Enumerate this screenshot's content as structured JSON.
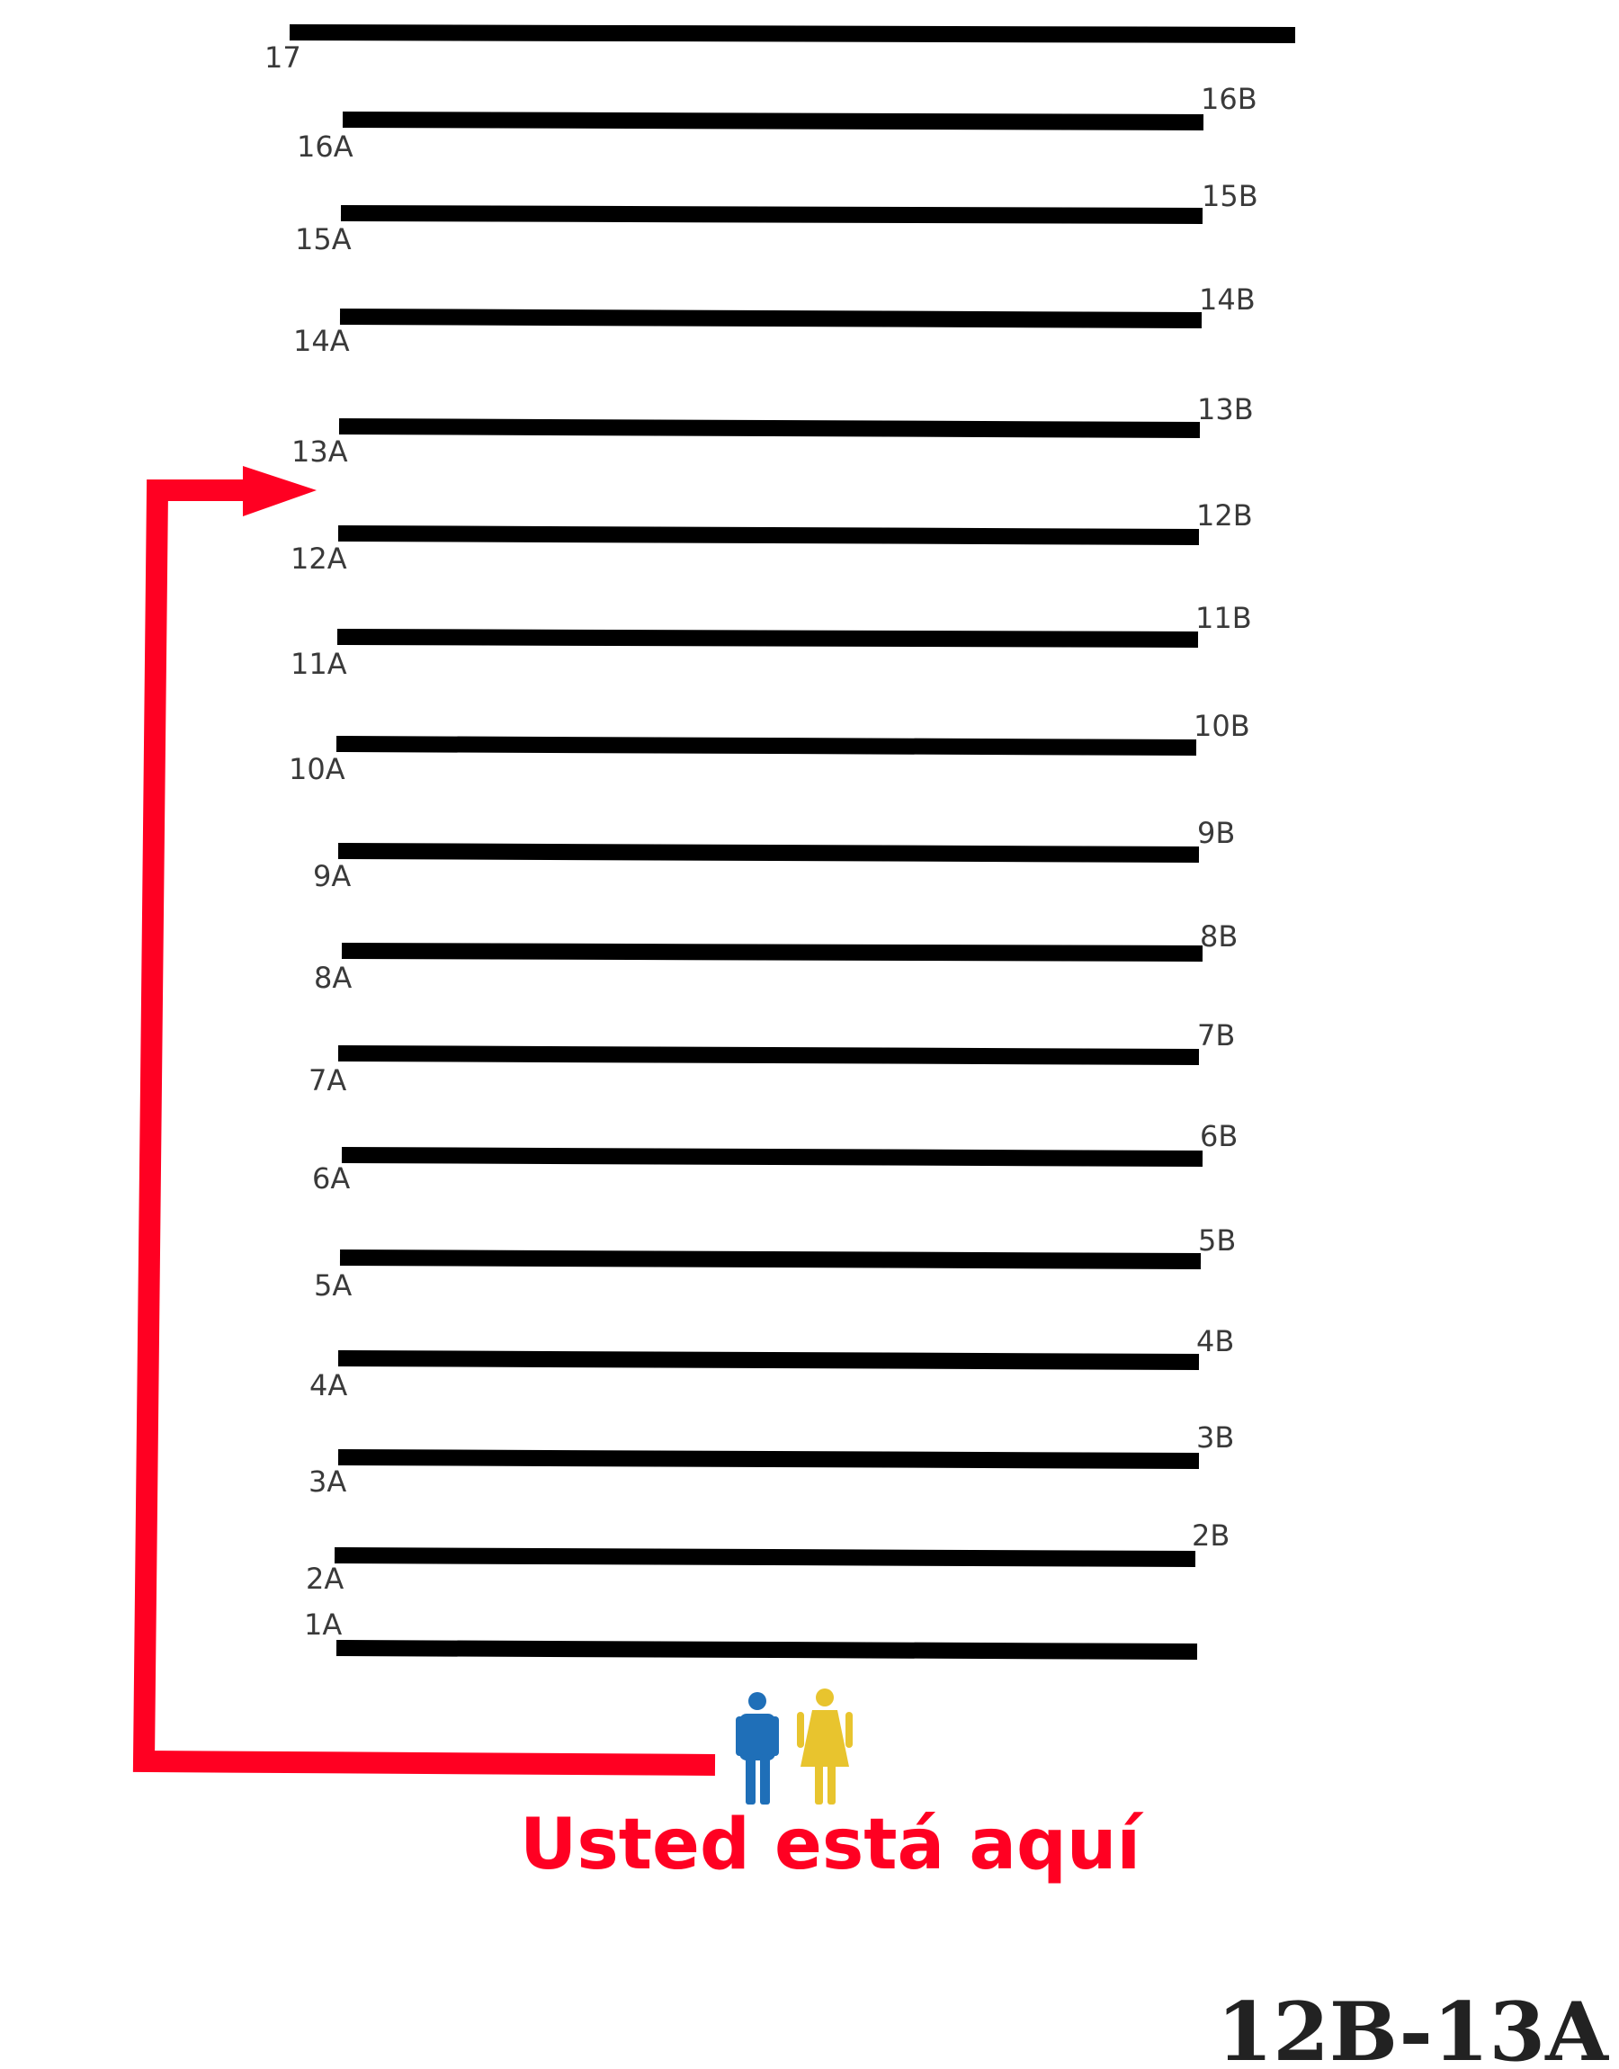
{
  "aisles": [
    {
      "id": "17",
      "label_a": "17",
      "label_b": ""
    },
    {
      "id": "16",
      "label_a": "16A",
      "label_b": "16B"
    },
    {
      "id": "15",
      "label_a": "15A",
      "label_b": "15B"
    },
    {
      "id": "14",
      "label_a": "14A",
      "label_b": "14B"
    },
    {
      "id": "13",
      "label_a": "13A",
      "label_b": "13B"
    },
    {
      "id": "12",
      "label_a": "12A",
      "label_b": "12B"
    },
    {
      "id": "11",
      "label_a": "11A",
      "label_b": "11B"
    },
    {
      "id": "10",
      "label_a": "10A",
      "label_b": "10B"
    },
    {
      "id": "9",
      "label_a": "9A",
      "label_b": "9B"
    },
    {
      "id": "8",
      "label_a": "8A",
      "label_b": "8B"
    },
    {
      "id": "7",
      "label_a": "7A",
      "label_b": "7B"
    },
    {
      "id": "6",
      "label_a": "6A",
      "label_b": "6B"
    },
    {
      "id": "5",
      "label_a": "5A",
      "label_b": "5B"
    },
    {
      "id": "4",
      "label_a": "4A",
      "label_b": "4B"
    },
    {
      "id": "3",
      "label_a": "3A",
      "label_b": "3B"
    },
    {
      "id": "2",
      "label_a": "2A",
      "label_b": "2B"
    },
    {
      "id": "1",
      "label_a": "1A",
      "label_b": ""
    }
  ],
  "you_are_here": "Usted está aquí",
  "destination_code": "12B-13A",
  "icons": {
    "restroom_men": "man-icon",
    "restroom_women": "woman-icon"
  },
  "colors": {
    "aisle": "#000000",
    "route": "#ff0022",
    "here_text": "#ff0022",
    "man": "#1f6fb8",
    "woman": "#e8c42e",
    "code_text": "#222222"
  }
}
